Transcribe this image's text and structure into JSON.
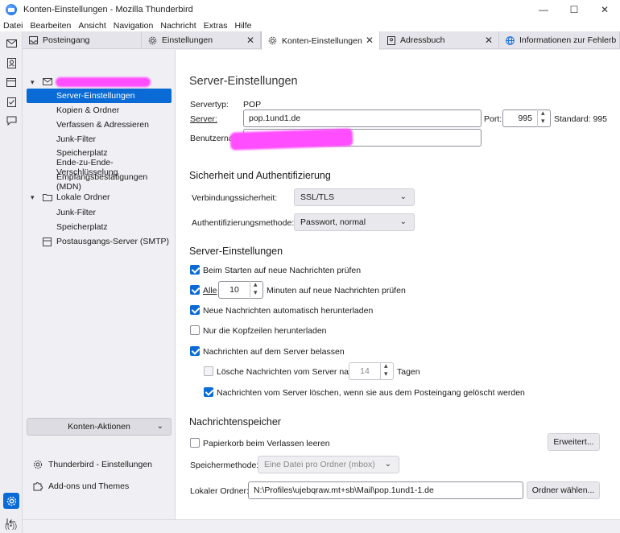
{
  "window": {
    "title": "Konten-Einstellungen - Mozilla Thunderbird",
    "minimize": "—",
    "maximize": "☐",
    "close": "✕"
  },
  "menu": [
    "Datei",
    "Bearbeiten",
    "Ansicht",
    "Navigation",
    "Nachricht",
    "Extras",
    "Hilfe"
  ],
  "tabs": [
    {
      "label": "Posteingang",
      "icon": "inbox-icon"
    },
    {
      "label": "Einstellungen",
      "icon": "gear-icon"
    },
    {
      "label": "Konten-Einstellungen",
      "icon": "gear-icon"
    },
    {
      "label": "Adressbuch",
      "icon": "addressbook-icon"
    },
    {
      "label": "Informationen zur Fehlerb",
      "icon": "globe-icon"
    }
  ],
  "sidebar": {
    "account_items": [
      "Server-Einstellungen",
      "Kopien & Ordner",
      "Verfassen & Adressieren",
      "Junk-Filter",
      "Speicherplatz",
      "Ende-zu-Ende-Verschlüsselung",
      "Empfangsbestätigungen (MDN)"
    ],
    "local_folders": "Lokale Ordner",
    "local_items": [
      "Junk-Filter",
      "Speicherplatz"
    ],
    "smtp": "Postausgangs-Server (SMTP)",
    "account_actions": "Konten-Aktionen",
    "tb_settings": "Thunderbird - Einstellungen",
    "addons": "Add-ons und Themes"
  },
  "main": {
    "title": "Server-Einstellungen",
    "servertype_label": "Servertyp:",
    "servertype_value": "POP",
    "server_label": "Server:",
    "server_value": "pop.1und1.de",
    "port_label": "Port:",
    "port_value": "995",
    "standard": "Standard: 995",
    "username_label": "Benutzernam",
    "security_heading": "Sicherheit und Authentifizierung",
    "conn_security_label": "Verbindungssicherheit:",
    "conn_security_value": "SSL/TLS",
    "auth_label": "Authentifizierungsmethode:",
    "auth_value": "Passwort, normal",
    "server_settings_heading": "Server-Einstellungen",
    "check_on_start": "Beim Starten auf neue Nachrichten prüfen",
    "every_label": "Alle",
    "every_value": "10",
    "every_suffix": "Minuten auf neue Nachrichten prüfen",
    "auto_download": "Neue Nachrichten automatisch herunterladen",
    "headers_only": "Nur die Kopfzeilen herunterladen",
    "leave_on_server": "Nachrichten auf dem Server belassen",
    "delete_after_prefix": "Lösche Nachrichten vom Server nach",
    "delete_after_value": "14",
    "delete_after_suffix": "Tagen",
    "delete_when_deleted": "Nachrichten vom Server löschen, wenn sie aus dem Posteingang gelöscht werden",
    "storage_heading": "Nachrichtenspeicher",
    "empty_trash": "Papierkorb beim Verlassen leeren",
    "advanced_button": "Erweitert...",
    "storage_method_label": "Speichermethode:",
    "storage_method_value": "Eine Datei pro Ordner (mbox)",
    "local_dir_label": "Lokaler Ordner:",
    "local_dir_value": "N:\\Profiles\\ujebqraw.mt+sb\\Mail\\pop.1und1-1.de",
    "choose_folder_button": "Ordner wählen..."
  },
  "colors": {
    "accent": "#0a6bd6",
    "redaction": "#ff4dff"
  }
}
